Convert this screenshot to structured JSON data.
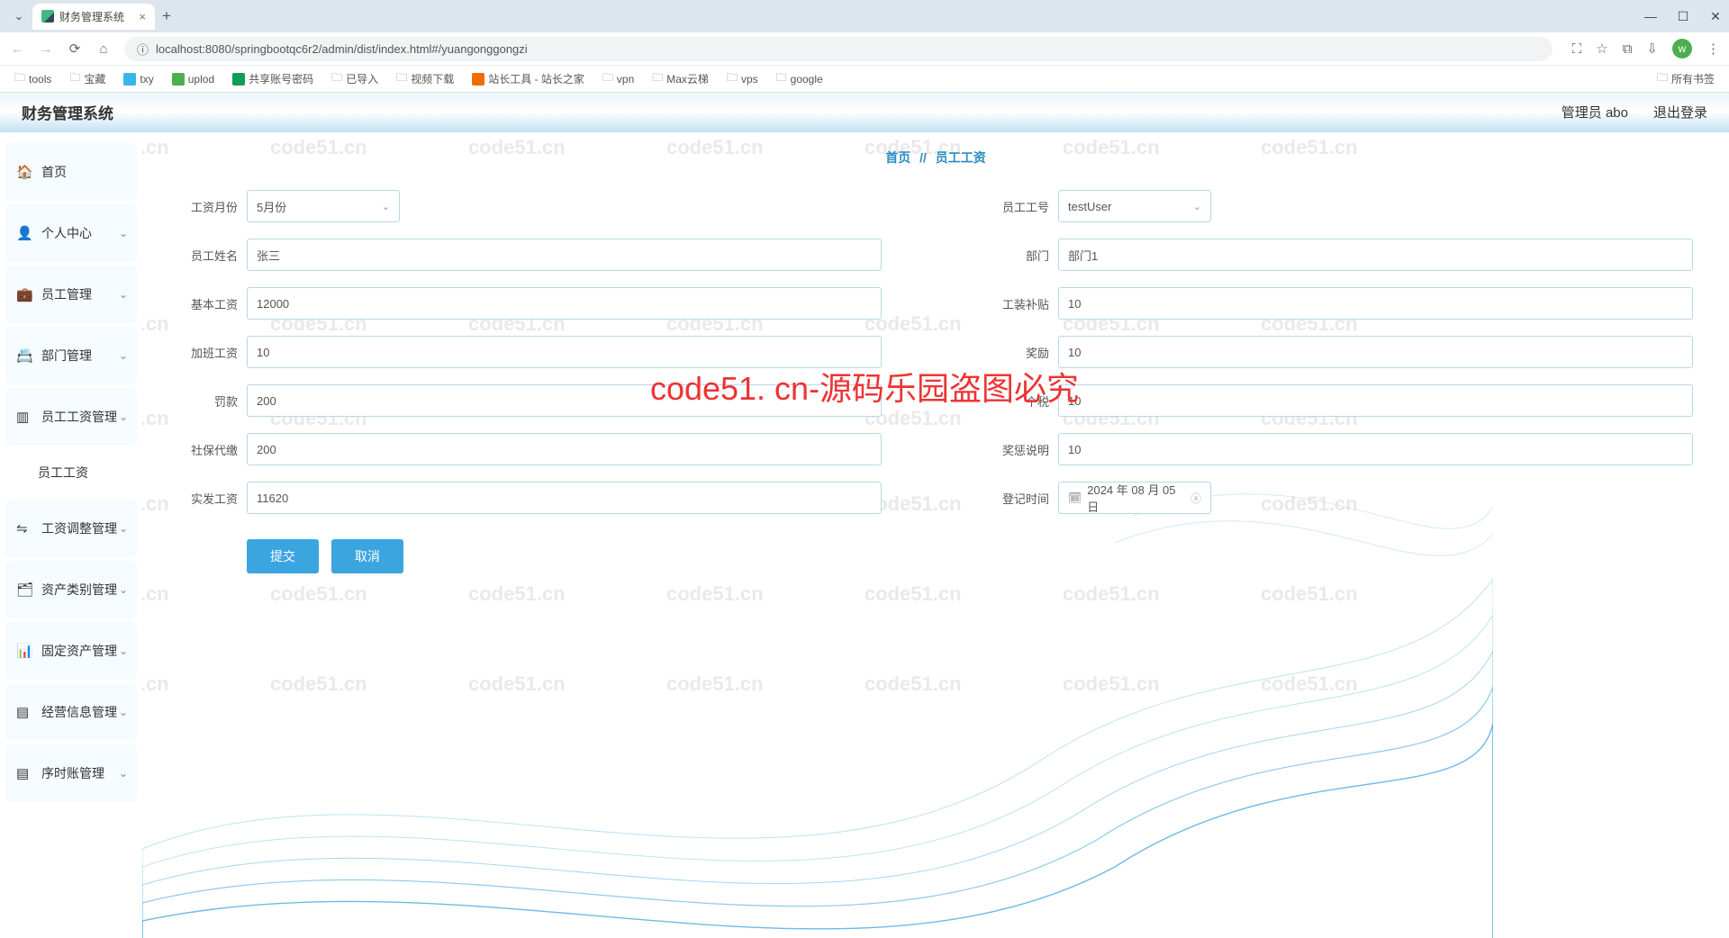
{
  "browser": {
    "tab_title": "财务管理系统",
    "url": "localhost:8080/springbootqc6r2/admin/dist/index.html#/yuangonggongzi",
    "bookmarks": [
      "tools",
      "宝藏",
      "txy",
      "uplod",
      "共享账号密码",
      "已导入",
      "视频下载",
      "站长工具 - 站长之家",
      "vpn",
      "Max云梯",
      "vps",
      "google"
    ],
    "all_bookmarks": "所有书签",
    "avatar_letter": "w"
  },
  "app": {
    "title": "财务管理系统",
    "user_label": "管理员 abo",
    "logout": "退出登录"
  },
  "sidebar": {
    "items": [
      {
        "icon": "🏠",
        "label": "首页",
        "expandable": false
      },
      {
        "icon": "👤",
        "label": "个人中心",
        "expandable": true
      },
      {
        "icon": "💼",
        "label": "员工管理",
        "expandable": true
      },
      {
        "icon": "📇",
        "label": "部门管理",
        "expandable": true
      },
      {
        "icon": "▥",
        "label": "员工工资管理",
        "expandable": true
      },
      {
        "icon": "",
        "label": "员工工资",
        "expandable": false,
        "sub": true
      },
      {
        "icon": "⇋",
        "label": "工资调整管理",
        "expandable": true
      },
      {
        "icon": "🗂",
        "label": "资产类别管理",
        "expandable": true
      },
      {
        "icon": "📊",
        "label": "固定资产管理",
        "expandable": true
      },
      {
        "icon": "▤",
        "label": "经营信息管理",
        "expandable": true
      },
      {
        "icon": "▤",
        "label": "序时账管理",
        "expandable": true
      }
    ]
  },
  "breadcrumb": {
    "home": "首页",
    "sep": "//",
    "current": "员工工资"
  },
  "form": {
    "left": [
      {
        "label": "工资月份",
        "type": "select",
        "value": "5月份"
      },
      {
        "label": "员工姓名",
        "type": "text",
        "value": "张三"
      },
      {
        "label": "基本工资",
        "type": "text",
        "value": "12000"
      },
      {
        "label": "加班工资",
        "type": "text",
        "value": "10"
      },
      {
        "label": "罚款",
        "type": "text",
        "value": "200"
      },
      {
        "label": "社保代缴",
        "type": "text",
        "value": "200"
      },
      {
        "label": "实发工资",
        "type": "text",
        "value": "11620"
      }
    ],
    "right": [
      {
        "label": "员工工号",
        "type": "select",
        "value": "testUser"
      },
      {
        "label": "部门",
        "type": "text",
        "value": "部门1"
      },
      {
        "label": "工装补贴",
        "type": "text",
        "value": "10"
      },
      {
        "label": "奖励",
        "type": "text",
        "value": "10"
      },
      {
        "label": "个税",
        "type": "text",
        "value": "10"
      },
      {
        "label": "奖惩说明",
        "type": "text",
        "value": "10"
      },
      {
        "label": "登记时间",
        "type": "date",
        "value": "2024 年 08 月 05 日"
      }
    ]
  },
  "buttons": {
    "submit": "提交",
    "cancel": "取消"
  },
  "center_text": "code51. cn-源码乐园盗图必究",
  "watermark": "code51.cn"
}
